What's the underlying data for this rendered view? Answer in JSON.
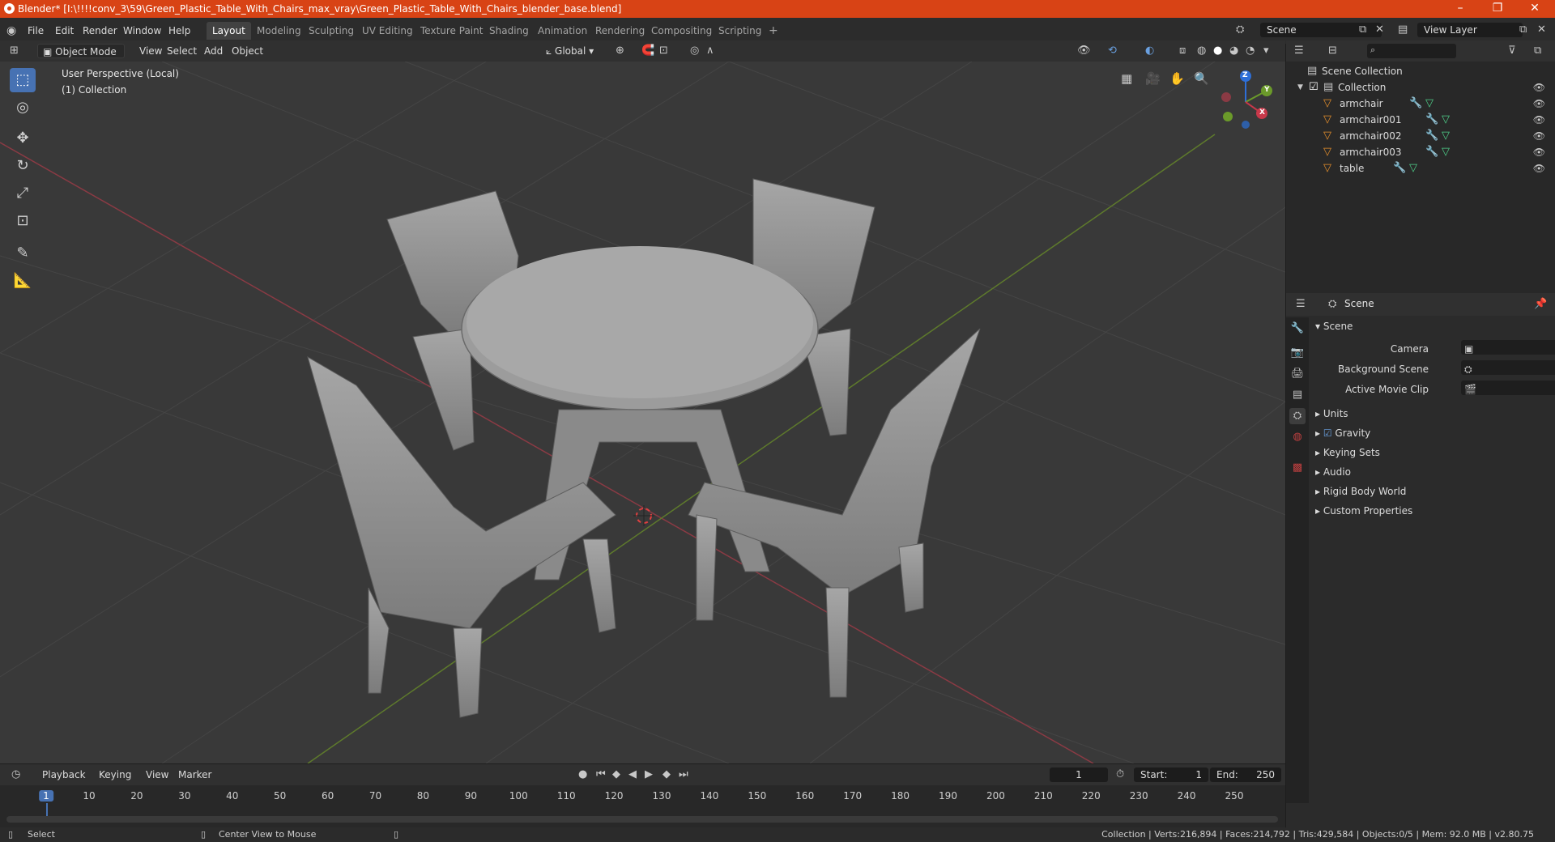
{
  "window": {
    "title": "Blender* [I:\\!!!!conv_3\\59\\Green_Plastic_Table_With_Chairs_max_vray\\Green_Plastic_Table_With_Chairs_blender_base.blend]",
    "minimize": "–",
    "maximize": "❐",
    "close": "✕"
  },
  "menu": {
    "items": [
      "File",
      "Edit",
      "Render",
      "Window",
      "Help"
    ]
  },
  "workspaces": {
    "tabs": [
      "Layout",
      "Modeling",
      "Sculpting",
      "UV Editing",
      "Texture Paint",
      "Shading",
      "Animation",
      "Rendering",
      "Compositing",
      "Scripting"
    ],
    "add": "+",
    "active": "Layout"
  },
  "scene_selector": {
    "value": "Scene"
  },
  "view_layer_selector": {
    "value": "View Layer"
  },
  "viewport_header": {
    "mode": "Object Mode",
    "menus": [
      "View",
      "Select",
      "Add",
      "Object"
    ],
    "transform_orientation": "Global"
  },
  "viewport": {
    "perspective_label": "User Perspective (Local)",
    "collection_label": "(1) Collection",
    "gizmo": {
      "x": "X",
      "y": "Y",
      "z": "Z"
    },
    "colors": {
      "x_axis": "#c8384a",
      "y_axis": "#6b9a2a",
      "z_axis": "#2e6fd8",
      "background": "#393939"
    }
  },
  "outliner": {
    "search_placeholder": "",
    "root": "Scene Collection",
    "collection": "Collection",
    "objects": [
      "armchair",
      "armchair001",
      "armchair002",
      "armchair003",
      "table"
    ]
  },
  "properties": {
    "header": "Scene",
    "panel_title": "Scene",
    "fields": [
      {
        "label": "Camera",
        "value": ""
      },
      {
        "label": "Background Scene",
        "value": ""
      },
      {
        "label": "Active Movie Clip",
        "value": ""
      }
    ],
    "panels": [
      "Units",
      "Gravity",
      "Keying Sets",
      "Audio",
      "Rigid Body World",
      "Custom Properties"
    ],
    "gravity_checked": true
  },
  "timeline": {
    "menus": [
      "Playback",
      "Keying",
      "View",
      "Marker"
    ],
    "current_frame": "1",
    "start_label": "Start:",
    "start": "1",
    "end_label": "End:",
    "end": "250",
    "ticks": [
      "1",
      "10",
      "20",
      "30",
      "40",
      "50",
      "60",
      "70",
      "80",
      "90",
      "100",
      "110",
      "120",
      "130",
      "140",
      "150",
      "160",
      "170",
      "180",
      "190",
      "200",
      "210",
      "220",
      "230",
      "240",
      "250"
    ]
  },
  "statusbar": {
    "select": "Select",
    "center_view": "Center View to Mouse",
    "stats": "Collection | Verts:216,894 | Faces:214,792 | Tris:429,584 | Objects:0/5 | Mem: 92.0 MB | v2.80.75"
  }
}
